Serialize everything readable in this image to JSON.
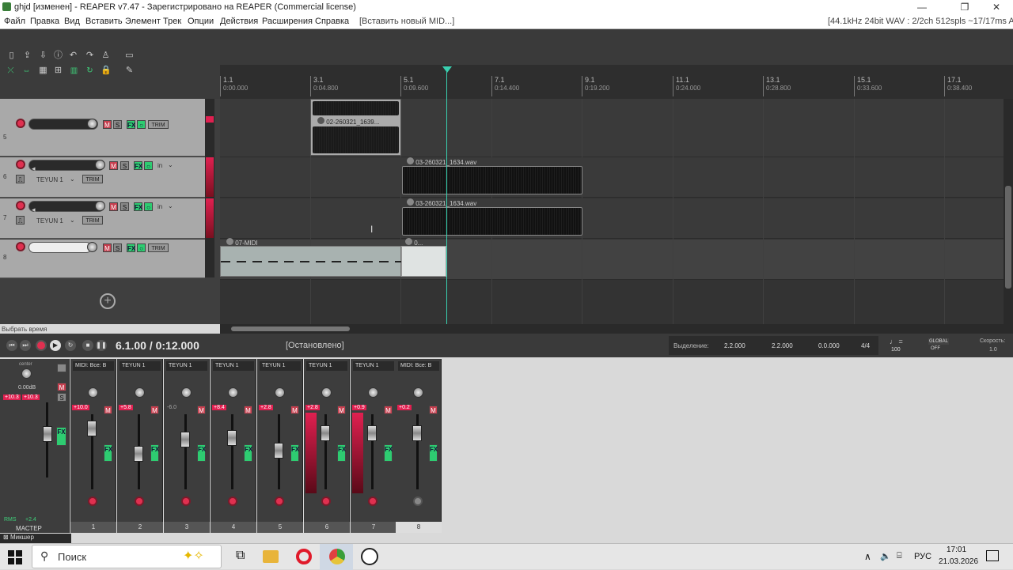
{
  "window": {
    "title": "ghjd [изменен] - REAPER v7.47 - Зарегистрировано на REAPER (Commercial license)",
    "minimize": "—",
    "maximize": "❐",
    "close": "✕"
  },
  "menu": {
    "items": [
      "Файл",
      "Правка",
      "Вид",
      "Вставить",
      "Элемент",
      "Трек",
      "Опции",
      "Действия",
      "Расширения",
      "Справка"
    ],
    "insert_midi": "[Вставить новый MID...]",
    "audio_status": "[44.1kHz 24bit WAV : 2/2ch 512spls ~17/17ms ASIO]"
  },
  "ruler": {
    "bars": [
      {
        "bar": "1.1",
        "time": "0:00.000"
      },
      {
        "bar": "3.1",
        "time": "0:04.800"
      },
      {
        "bar": "5.1",
        "time": "0:09.600"
      },
      {
        "bar": "7.1",
        "time": "0:14.400"
      },
      {
        "bar": "9.1",
        "time": "0:19.200"
      },
      {
        "bar": "11.1",
        "time": "0:24.000"
      },
      {
        "bar": "13.1",
        "time": "0:28.800"
      },
      {
        "bar": "15.1",
        "time": "0:33.600"
      },
      {
        "bar": "17.1",
        "time": "0:38.400"
      }
    ]
  },
  "tracks": [
    {
      "num": "5",
      "input_label": "",
      "route": ""
    },
    {
      "num": "6",
      "input_label": "ТЕYUN 1",
      "route": "in"
    },
    {
      "num": "7",
      "input_label": "ТЕYUN 1",
      "route": "in"
    },
    {
      "num": "8",
      "input_label": "",
      "route": ""
    }
  ],
  "track_buttons": {
    "m": "M",
    "s": "S",
    "fx": "FX",
    "trim": "TRIM"
  },
  "items": {
    "item_top": "02-260321_1639...",
    "item_a": "03-260321_1634.wav",
    "item_b": "03-260321_1634.wav",
    "midi": "07-MIDI",
    "midi2": "0..."
  },
  "status": {
    "select_time": "Выбрать время"
  },
  "transport": {
    "position": "6.1.00 / 0:12.000",
    "state": "[Остановлено]",
    "selection_label": "Выделение:",
    "sel_start": "2.2.000",
    "sel_end": "2.2.000",
    "sel_len": "0.0.000",
    "timesig": "4/4",
    "bpm": "100",
    "global_label": "GLOBAL",
    "global_state": "OFF",
    "speed_label": "Скорость:",
    "speed": "1.0"
  },
  "mixer": {
    "master_label": "МАСТЕР",
    "master_db": "0.00dB",
    "master_center": "center",
    "master_rms": "RMS",
    "master_rms_val": "+2.4",
    "master_peaks": [
      "+10.3",
      "+10.3"
    ],
    "label": "Микшер",
    "strips": [
      {
        "name": "MIDI: Все: В",
        "peak": "+10.0",
        "hot": true,
        "num": "1"
      },
      {
        "name": "ТЕYUN 1",
        "peak": "+5.8",
        "hot": true,
        "num": "2"
      },
      {
        "name": "ТЕYUN 1",
        "peak": "-6.0",
        "hot": false,
        "num": "3"
      },
      {
        "name": "ТЕYUN 1",
        "peak": "+8.4",
        "hot": true,
        "num": "4"
      },
      {
        "name": "ТЕYUN 1",
        "peak": "+2.8",
        "hot": true,
        "num": "5"
      },
      {
        "name": "ТЕYUN 1",
        "peak": "+2.8",
        "hot": true,
        "num": "6"
      },
      {
        "name": "ТЕYUN 1",
        "peak": "+0.9",
        "hot": true,
        "num": "7"
      },
      {
        "name": "MIDI: Все: В",
        "peak": "+0.2",
        "hot": true,
        "num": "8"
      }
    ]
  },
  "taskbar": {
    "search": "Поиск",
    "lang": "РУС",
    "time": "17:01",
    "date": "21.03.2026"
  },
  "colors": {
    "accent": "#39d0b0",
    "rec": "#e03050",
    "fx": "#2ecc71"
  }
}
